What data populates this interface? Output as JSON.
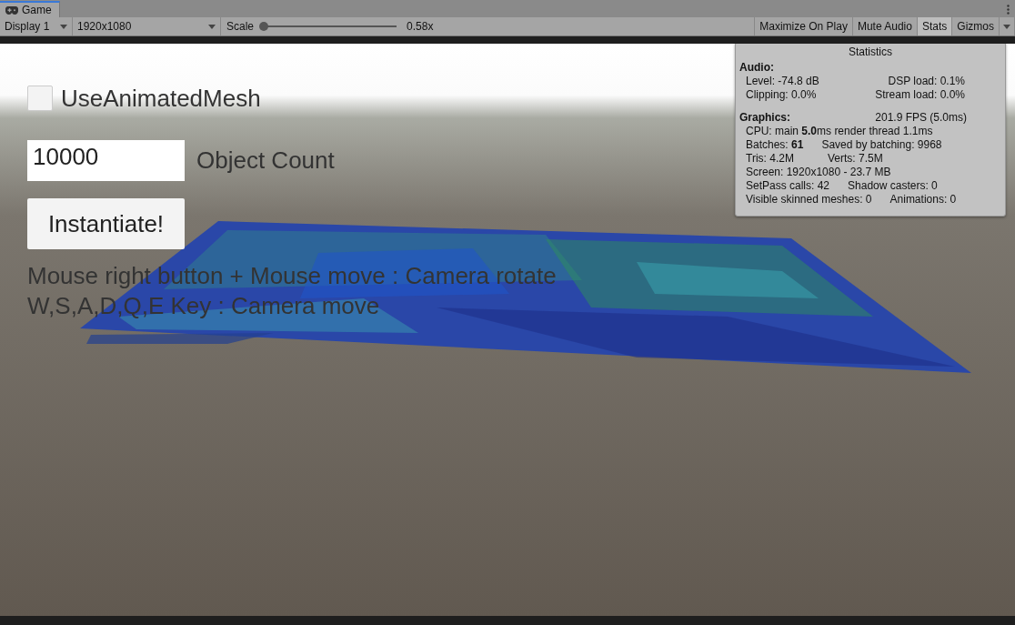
{
  "tab": {
    "label": "Game",
    "selected": true
  },
  "toolbar": {
    "display": "Display 1",
    "resolution": "1920x1080",
    "scale_label": "Scale",
    "scale": {
      "level": 0,
      "reading": "0.58x"
    },
    "toggles": [
      {
        "label": "Maximize On Play",
        "on": false
      },
      {
        "label": "Mute Audio",
        "on": false
      },
      {
        "label": "Stats",
        "on": true
      },
      {
        "label": "Gizmos",
        "on": false
      }
    ]
  },
  "game_view": {
    "kind": "picture",
    "checkbox": {
      "label": "UseAnimatedMesh",
      "checked": false
    },
    "count_field": {
      "value": "10000",
      "label": "Object Count"
    },
    "button": "Instantiate!",
    "instructions": [
      "Mouse right button + Mouse move : Camera rotate",
      "W,S,A,D,Q,E Key : Camera move"
    ]
  },
  "statistics": {
    "title": "Statistics",
    "sections": [
      {
        "header": "Audio:",
        "rows": [
          [
            "Level: -74.8 dB",
            "DSP load: 0.1%"
          ],
          [
            "Clipping: 0.0%",
            "Stream load: 0.0%"
          ]
        ]
      },
      {
        "header": "Graphics:",
        "header_note": "201.9 FPS (5.0ms)",
        "rows": [
          [
            "CPU: main **5.0**ms  render thread 1.1ms"
          ],
          [
            "Batches: **61**",
            "Saved by batching: 9968"
          ],
          [
            "Tris: 4.2M",
            "Verts: 7.5M"
          ],
          [
            "Screen: 1920x1080 - 23.7 MB"
          ],
          [
            "SetPass calls: 42",
            "Shadow casters: 0"
          ],
          [
            "Visible skinned meshes: 0",
            "Animations: 0"
          ]
        ]
      }
    ]
  }
}
